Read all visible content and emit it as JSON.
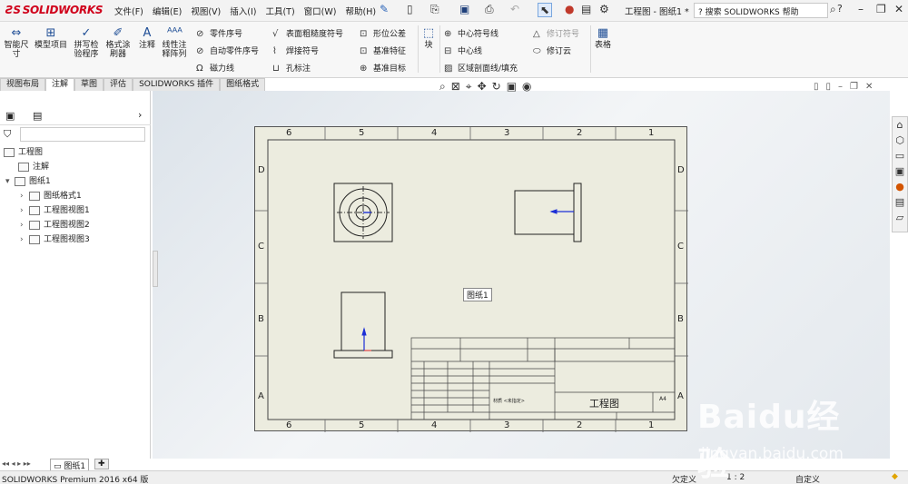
{
  "app": {
    "logo": "SOLIDWORKS",
    "title": "工程图 - 图纸1 *",
    "help_search_placeholder": "搜索 SOLIDWORKS 帮助"
  },
  "menu": [
    "文件(F)",
    "编辑(E)",
    "视图(V)",
    "插入(I)",
    "工具(T)",
    "窗口(W)",
    "帮助(H)"
  ],
  "ribbon": {
    "big_buttons": [
      "智能尺寸",
      "模型项目",
      "拼写检验程序",
      "格式涂刷器",
      "注释",
      "线性注释阵列"
    ],
    "col1": [
      "零件序号",
      "自动零件序号",
      "磁力线"
    ],
    "col2": [
      "表面粗糙度符号",
      "焊接符号",
      "孔标注"
    ],
    "col3": [
      "形位公差",
      "基准特征",
      "基准目标"
    ],
    "block": "块",
    "col4": [
      "中心符号线",
      "中心线",
      "区域剖面线/填充"
    ],
    "col5": [
      "修订符号",
      "修订云"
    ],
    "table": "表格"
  },
  "tabs": [
    "视图布局",
    "注解",
    "草图",
    "评估",
    "SOLIDWORKS 插件",
    "图纸格式"
  ],
  "active_tab": "注解",
  "tree": {
    "root": "工程图",
    "items": [
      "注解",
      "图纸1",
      "图纸格式1",
      "工程图视图1",
      "工程图视图2",
      "工程图视图3"
    ]
  },
  "sheet": {
    "top_cols": [
      "6",
      "5",
      "4",
      "3",
      "2",
      "1"
    ],
    "rows": [
      "D",
      "C",
      "B",
      "A"
    ],
    "label": "图纸1",
    "title_name": "工程图",
    "size": "A4",
    "material": "材质 <未指定>"
  },
  "sheet_tab": "图纸1",
  "status": {
    "version": "SOLIDWORKS Premium 2016 x64 版",
    "state": "欠定义",
    "scale": "1 : 2",
    "custom": "自定义"
  },
  "watermark": {
    "brand": "Baidu经验",
    "url": "jingyan.baidu.com"
  }
}
